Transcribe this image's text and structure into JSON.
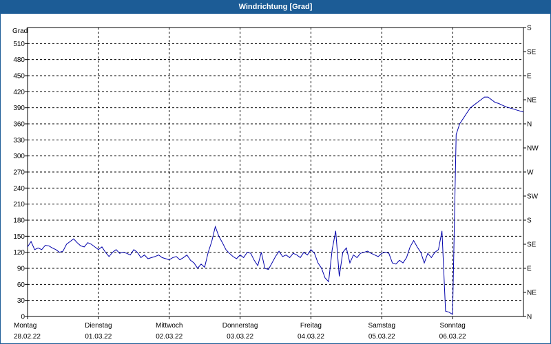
{
  "window": {
    "title": "Windrichtung [Grad]"
  },
  "colors": {
    "title_bg": "#1c5c96",
    "line": "#0000aa",
    "grid": "#000000",
    "axis": "#000000"
  },
  "chart_data": {
    "type": "line",
    "title": "Windrichtung [Grad]",
    "ylabel": "Grad",
    "ylim": [
      0,
      540
    ],
    "yticks": [
      0,
      30,
      60,
      90,
      120,
      150,
      180,
      210,
      240,
      270,
      300,
      330,
      360,
      390,
      420,
      450,
      480,
      510
    ],
    "right_axis_labels": [
      {
        "value": 0,
        "label": "N"
      },
      {
        "value": 30,
        "label": "NE"
      },
      {
        "value": 60,
        "label": "E"
      },
      {
        "value": 90,
        "label": "SE"
      },
      {
        "value": 120,
        "label": "S"
      },
      {
        "value": 150,
        "label": "SW"
      },
      {
        "value": 180,
        "label": "W"
      },
      {
        "value": 210,
        "label": "NW"
      },
      {
        "value": 240,
        "label": "N"
      },
      {
        "value": 270,
        "label": "NE"
      },
      {
        "value": 300,
        "label": "E"
      },
      {
        "value": 330,
        "label": "SE"
      },
      {
        "value": 360,
        "label": "S"
      }
    ],
    "xlim": [
      0,
      7
    ],
    "x_ticks": [
      {
        "day": "Montag",
        "date": "28.02.22"
      },
      {
        "day": "Dienstag",
        "date": "01.03.22"
      },
      {
        "day": "Mittwoch",
        "date": "02.03.22"
      },
      {
        "day": "Donnerstag",
        "date": "03.03.22"
      },
      {
        "day": "Freitag",
        "date": "04.03.22"
      },
      {
        "day": "Samstag",
        "date": "05.03.22"
      },
      {
        "day": "Sonntag",
        "date": "06.03.22"
      }
    ],
    "grid": true,
    "series": [
      {
        "x": [
          0,
          0.05,
          0.1,
          0.15,
          0.2,
          0.25,
          0.3,
          0.35,
          0.4,
          0.45,
          0.5,
          0.55,
          0.6,
          0.65,
          0.7,
          0.75,
          0.8,
          0.85,
          0.9,
          0.95,
          1.0,
          1.05,
          1.1,
          1.15,
          1.2,
          1.25,
          1.3,
          1.35,
          1.4,
          1.45,
          1.5,
          1.55,
          1.6,
          1.65,
          1.7,
          1.75,
          1.8,
          1.85,
          1.9,
          1.95,
          2.0,
          2.05,
          2.1,
          2.15,
          2.2,
          2.25,
          2.3,
          2.35,
          2.4,
          2.45,
          2.5,
          2.55,
          2.6,
          2.65,
          2.7,
          2.75,
          2.8,
          2.85,
          2.9,
          2.95,
          3.0,
          3.05,
          3.1,
          3.15,
          3.2,
          3.25,
          3.3,
          3.35,
          3.4,
          3.45,
          3.5,
          3.55,
          3.6,
          3.65,
          3.7,
          3.75,
          3.8,
          3.85,
          3.9,
          3.95,
          4.0,
          4.05,
          4.1,
          4.15,
          4.2,
          4.25,
          4.3,
          4.35,
          4.4,
          4.45,
          4.5,
          4.55,
          4.6,
          4.65,
          4.7,
          4.75,
          4.8,
          4.85,
          4.9,
          4.95,
          5.0,
          5.05,
          5.1,
          5.15,
          5.2,
          5.25,
          5.3,
          5.35,
          5.4,
          5.45,
          5.5,
          5.55,
          5.6,
          5.65,
          5.7,
          5.75,
          5.8,
          5.85,
          5.9,
          5.95,
          6.0,
          6.05,
          6.1,
          6.15,
          6.2,
          6.25,
          6.3,
          6.35,
          6.4,
          6.45,
          6.5,
          6.55,
          6.6,
          6.65,
          6.7,
          6.75,
          6.8,
          6.85,
          6.9,
          6.95,
          7.0
        ],
        "y": [
          130,
          140,
          125,
          128,
          125,
          133,
          132,
          128,
          125,
          120,
          122,
          135,
          140,
          145,
          138,
          132,
          130,
          138,
          135,
          130,
          125,
          130,
          120,
          112,
          120,
          125,
          118,
          120,
          118,
          115,
          125,
          120,
          110,
          115,
          108,
          110,
          112,
          115,
          110,
          108,
          106,
          110,
          112,
          106,
          110,
          115,
          105,
          100,
          90,
          98,
          92,
          120,
          140,
          168,
          150,
          138,
          125,
          118,
          112,
          108,
          115,
          110,
          120,
          118,
          105,
          95,
          120,
          90,
          88,
          100,
          112,
          122,
          112,
          115,
          110,
          118,
          115,
          110,
          120,
          115,
          125,
          118,
          100,
          90,
          72,
          65,
          125,
          160,
          75,
          120,
          128,
          100,
          115,
          110,
          118,
          120,
          122,
          118,
          115,
          112,
          118,
          120,
          118,
          100,
          98,
          105,
          100,
          110,
          130,
          142,
          130,
          120,
          100,
          118,
          110,
          120,
          125,
          160,
          10,
          8,
          4,
          340,
          360,
          370,
          380,
          390,
          395,
          400,
          405,
          410,
          410,
          405,
          400,
          398,
          395,
          392,
          390,
          388,
          386,
          384,
          382
        ]
      }
    ]
  }
}
